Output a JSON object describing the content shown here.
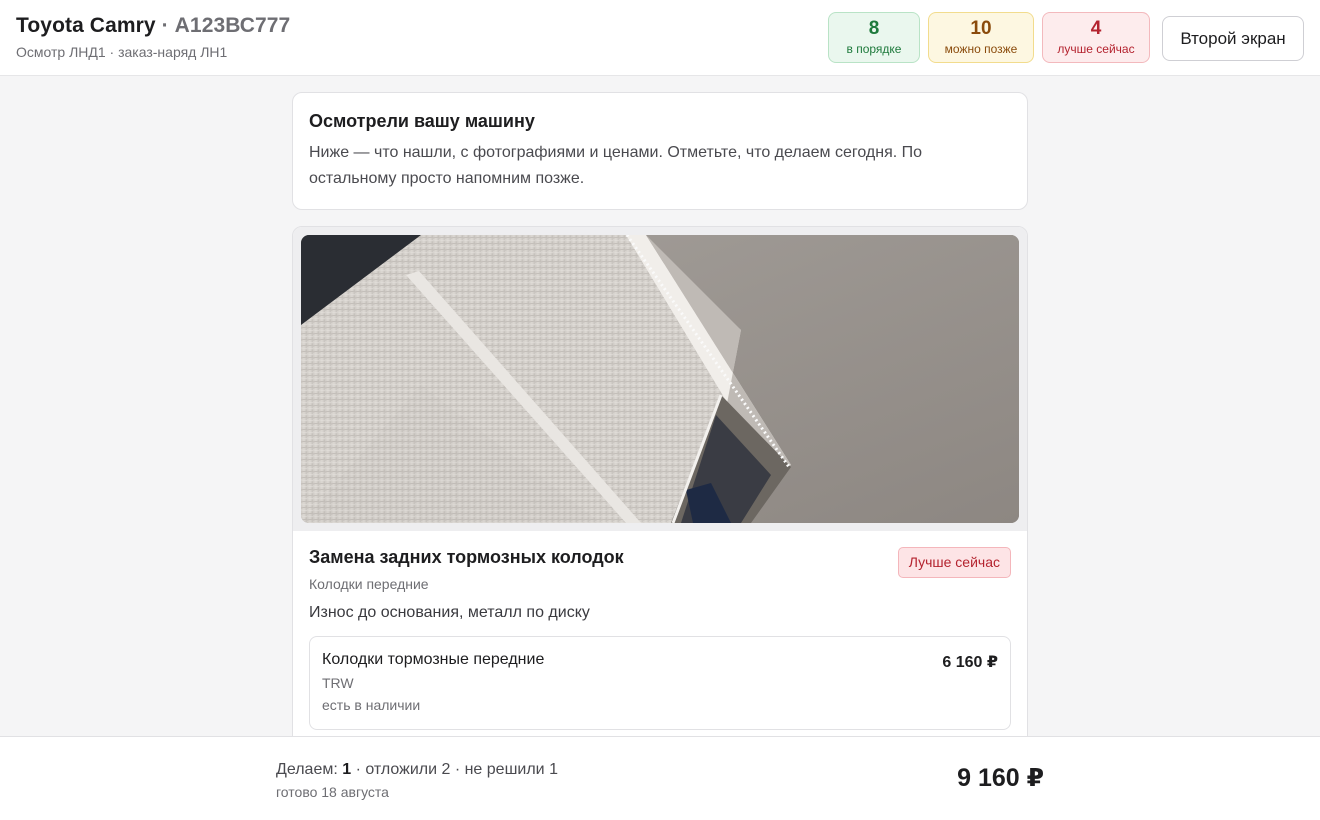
{
  "header": {
    "car_name": "Toyota Camry",
    "separator": " · ",
    "plate": "А123ВС777",
    "subtitle": "Осмотр ЛНД1 · заказ-наряд ЛН1",
    "stats": {
      "ok": {
        "count": "8",
        "label": "в порядке",
        "color": "#1e7a3c"
      },
      "later": {
        "count": "10",
        "label": "можно позже",
        "color": "#8a4b0c"
      },
      "now": {
        "count": "4",
        "label": "лучше сейчас",
        "color": "#b4232f"
      }
    },
    "second_screen_label": "Второй экран"
  },
  "intro": {
    "title": "Осмотрели вашу машину",
    "text": "Ниже — что нашли, с фотографиями и ценами. Отметьте, что делаем сегодня. По остальному просто напомним позже."
  },
  "item": {
    "title": "Замена задних тормозных колодок",
    "subtitle": "Колодки передние",
    "description": "Износ до основания, металл по диску",
    "badge": "Лучше сейчас",
    "part": {
      "name": "Колодки тормозные передние",
      "brand": "TRW",
      "stock": "есть в наличии",
      "price": "6 160 ₽"
    }
  },
  "footer": {
    "doing_label": "Делаем: ",
    "doing_count": "1",
    "rest": " · отложили 2 · не решили 1",
    "ready": "готово 18 августа",
    "total": "9 160 ₽"
  }
}
